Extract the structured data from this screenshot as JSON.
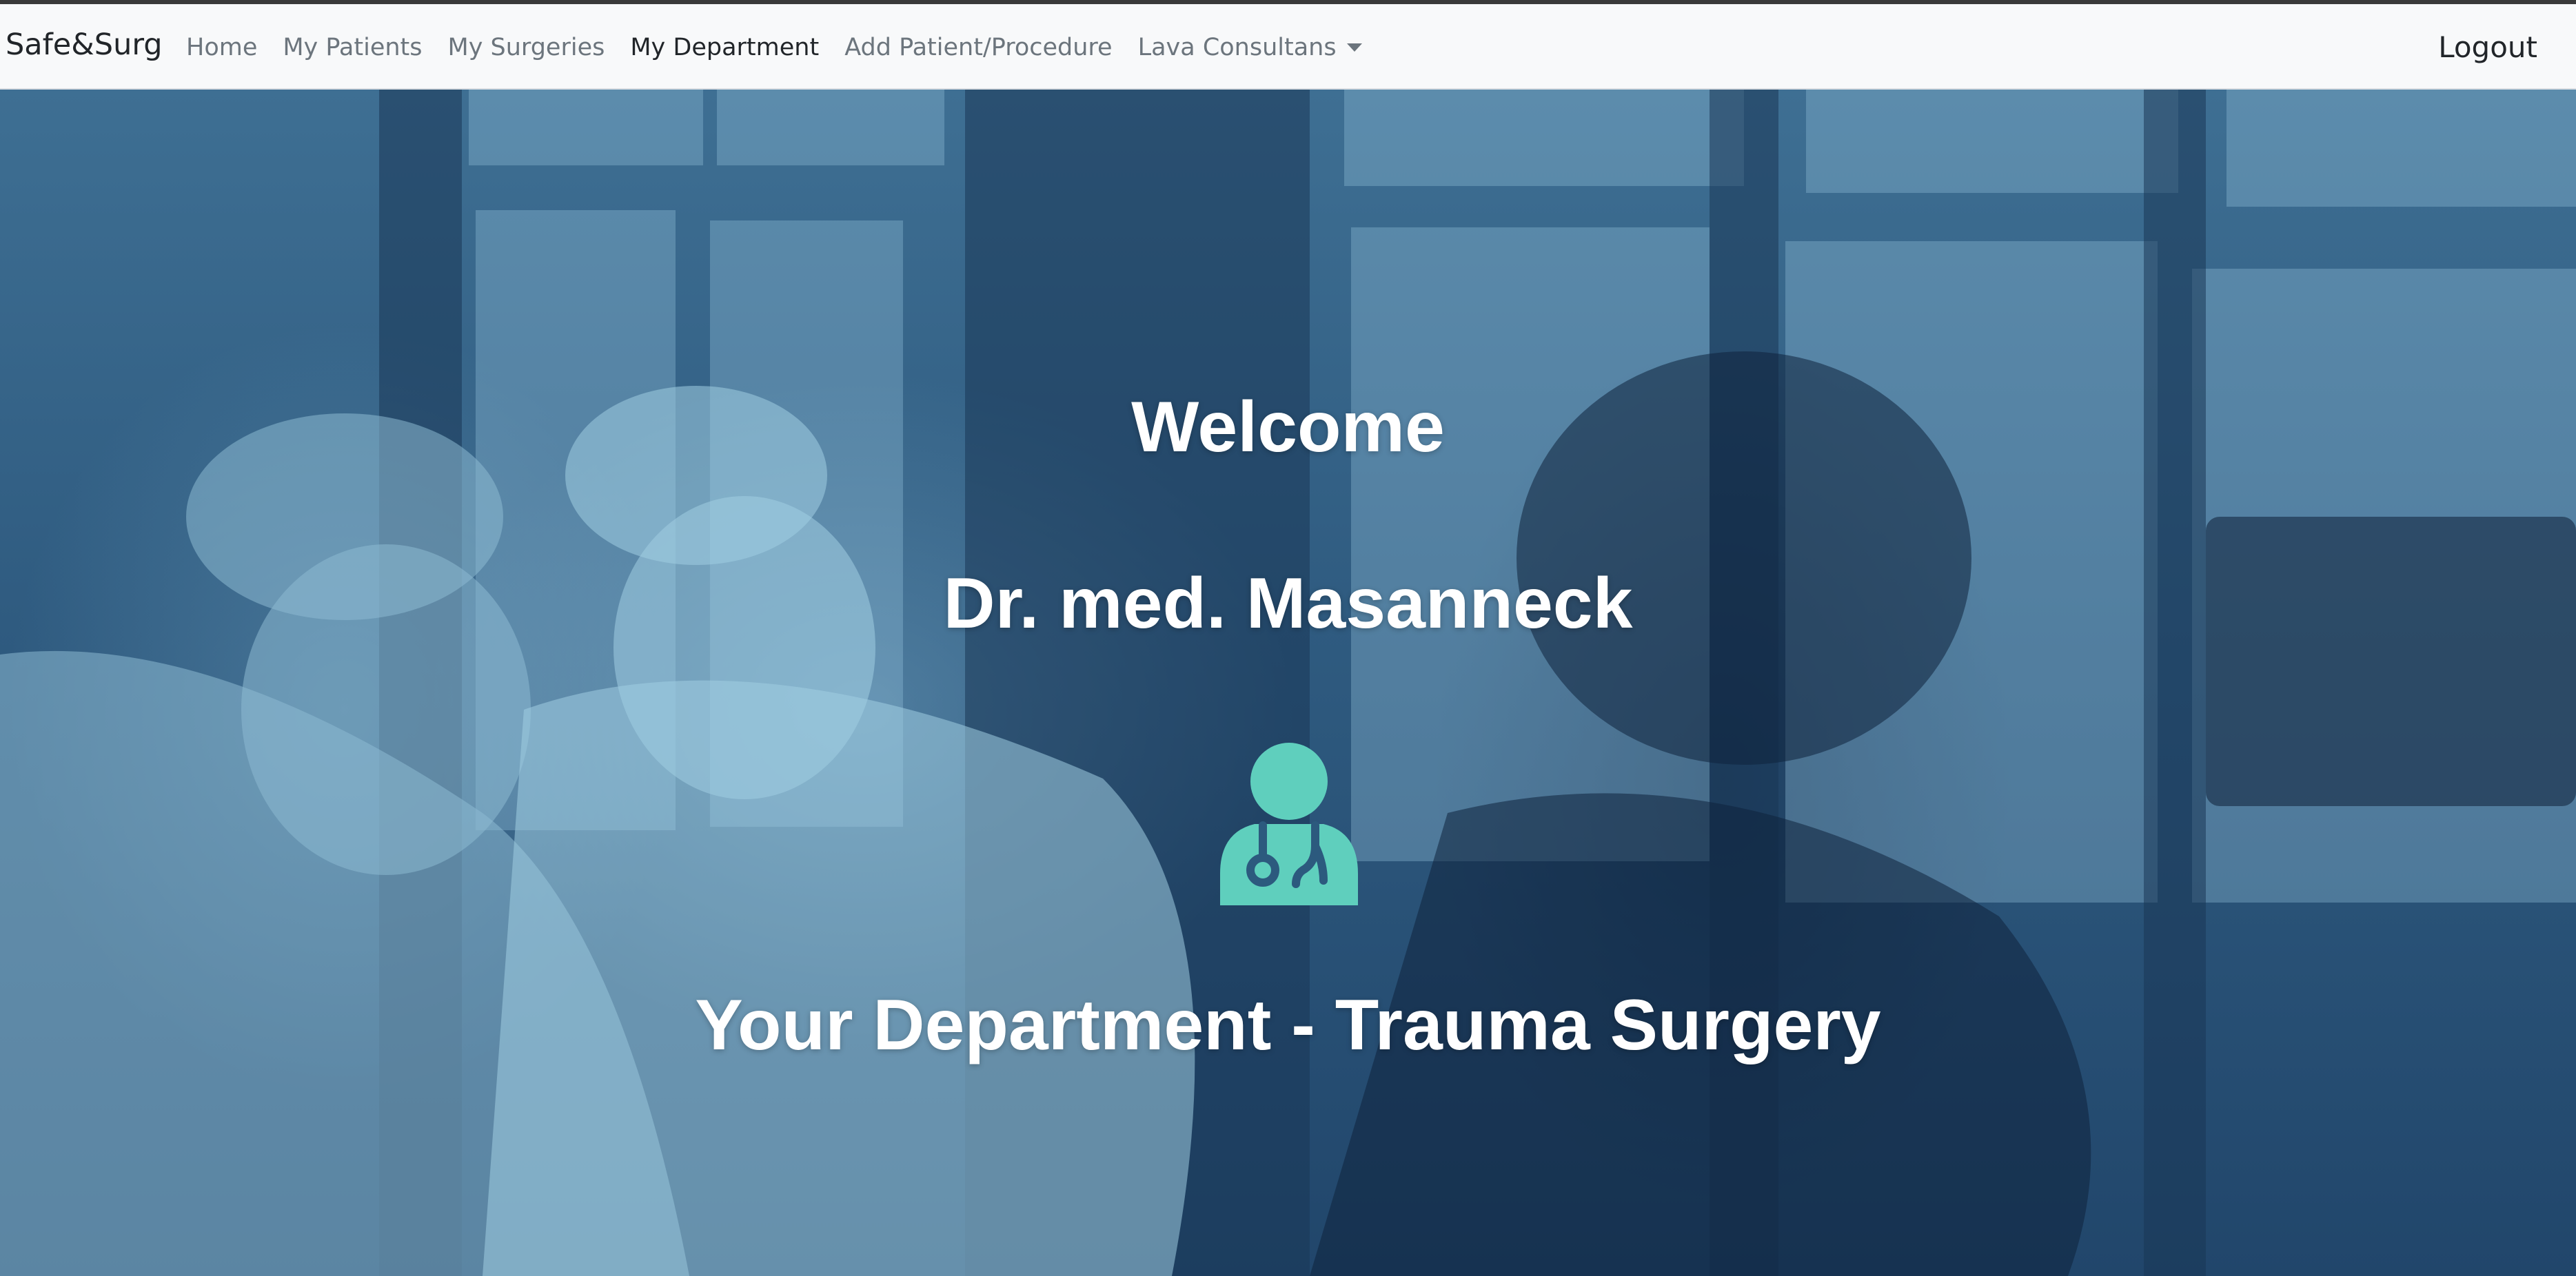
{
  "navbar": {
    "brand": "Safe&Surg",
    "links": [
      {
        "label": "Home",
        "active": false
      },
      {
        "label": "My Patients",
        "active": false
      },
      {
        "label": "My Surgeries",
        "active": false
      },
      {
        "label": "My Department",
        "active": true
      },
      {
        "label": "Add Patient/Procedure",
        "active": false
      }
    ],
    "dropdown_label": "Lava Consultans",
    "logout_label": "Logout"
  },
  "hero": {
    "welcome": "Welcome",
    "doctor_name": "Dr. med. Masanneck",
    "department": "Your Department - Trauma Surgery",
    "icon": "user-doctor-icon",
    "icon_color": "#5fcfbd",
    "overlay_color": "#2a5479"
  }
}
